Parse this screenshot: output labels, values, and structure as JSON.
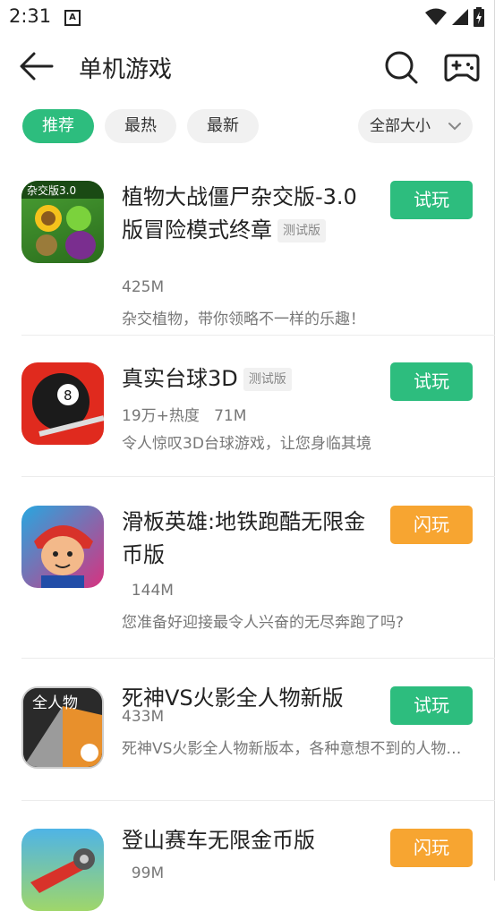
{
  "status_bar": {
    "time": "2:31",
    "notif_glyph": "A"
  },
  "header": {
    "title": "单机游戏"
  },
  "filters": {
    "chips": [
      {
        "label": "推荐",
        "active": true
      },
      {
        "label": "最热",
        "active": false
      },
      {
        "label": "最新",
        "active": false
      }
    ],
    "size_select": "全部大小"
  },
  "games": [
    {
      "name": "植物大战僵尸杂交版-3.0版冒险模式终章",
      "badge": "测试版",
      "meta": "425M",
      "desc": "杂交植物，带你领略不一样的乐趣！",
      "action": "试玩",
      "action_color": "#2dbd7e",
      "icon_text": "杂交版3.0"
    },
    {
      "name": "真实台球3D",
      "badge": "测试版",
      "meta": "19万+热度   71M",
      "desc": "令人惊叹3D台球游戏，让您身临其境",
      "action": "试玩",
      "action_color": "#2dbd7e",
      "icon_text": "8"
    },
    {
      "name": "滑板英雄:地铁跑酷无限金币版",
      "badge": "",
      "meta": "  144M",
      "desc": "您准备好迎接最令人兴奋的无尽奔跑了吗?",
      "action": "闪玩",
      "action_color": "#f7a531",
      "icon_text": ""
    },
    {
      "name": "死神VS火影全人物新版",
      "badge": "",
      "meta": "433M",
      "desc": "死神VS火影全人物新版本，各种意想不到的人物等你来战",
      "action": "试玩",
      "action_color": "#2dbd7e",
      "icon_text": "全人物"
    },
    {
      "name": "登山赛车无限金币版",
      "badge": "",
      "meta": "  99M",
      "desc": "",
      "action": "闪玩",
      "action_color": "#f7a531",
      "icon_text": ""
    }
  ],
  "colors": {
    "accent_green": "#2dbd7e",
    "accent_orange": "#f7a531"
  }
}
